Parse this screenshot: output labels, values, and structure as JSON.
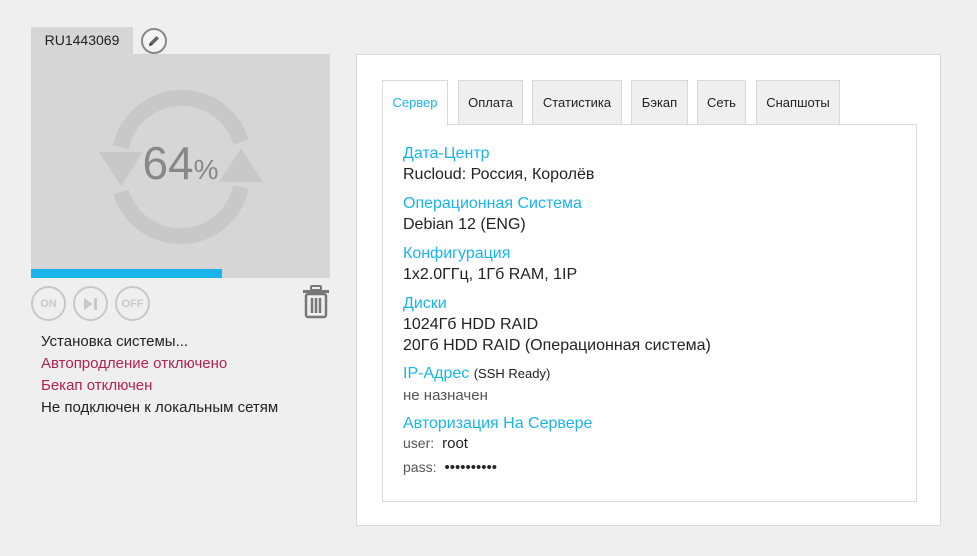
{
  "server": {
    "id": "RU1443069",
    "progress_percent": 64,
    "percent_symbol": "%",
    "controls": {
      "on": "ON",
      "off": "OFF"
    },
    "status": [
      "Установка системы...",
      "Автопродление отключено",
      "Бекап отключен",
      "Не подключен к локальным сетям"
    ]
  },
  "tabs": [
    "Сервер",
    "Оплата",
    "Статистика",
    "Бэкап",
    "Сеть",
    "Снапшоты"
  ],
  "active_tab": 0,
  "details": {
    "datacenter_label": "Дата-Центр",
    "datacenter_value": "Rucloud: Россия, Королёв",
    "os_label": "Операционная Система",
    "os_value": "Debian 12 (ENG)",
    "config_label": "Конфигурация",
    "config_value": "1x2.0ГГц, 1Гб RAM, 1IP",
    "disks_label": "Диски",
    "disks": [
      "1024Гб HDD RAID",
      "20Гб HDD RAID (Операционная система)"
    ],
    "ip_label": "IP-Адрес",
    "ip_note": "(SSH Ready)",
    "ip_value": "не назначен",
    "auth_label": "Авторизация На Сервере",
    "user_key": "user:",
    "user_value": "root",
    "pass_key": "pass:",
    "pass_value": "••••••••••"
  },
  "colors": {
    "accent": "#19b4ec",
    "warning": "#b0234f",
    "card_bg": "#d6d6d6"
  }
}
